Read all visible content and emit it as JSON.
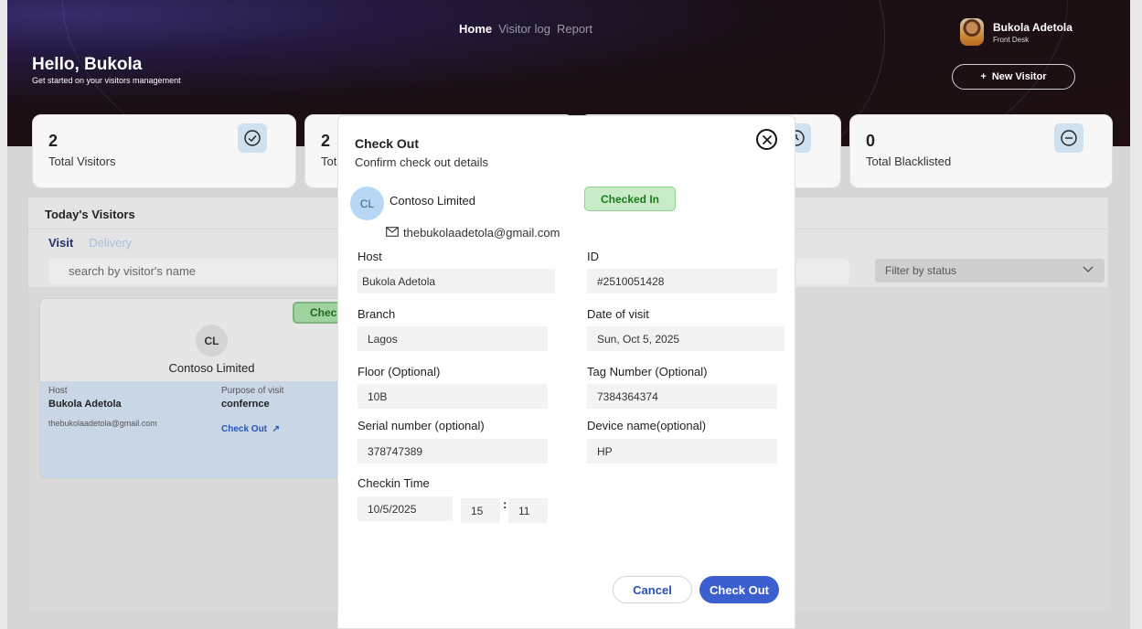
{
  "header": {
    "greeting": "Hello, Bukola",
    "subtitle": "Get started on your visitors management",
    "nav": [
      "Home",
      "Visitor log",
      "Report"
    ],
    "active_nav": "Home",
    "user_name": "Bukola Adetola",
    "user_role": "Front Desk",
    "new_visitor_label": "New Visitor"
  },
  "stats": [
    {
      "value": "2",
      "label": "Total Visitors",
      "icon": "check-circle-icon"
    },
    {
      "value": "2",
      "label": "Tot",
      "icon": "arrow-icon"
    },
    {
      "value": "",
      "label": "",
      "icon": "clock-icon"
    },
    {
      "value": "0",
      "label": "Total Blacklisted",
      "icon": "minus-circle-icon"
    }
  ],
  "panel": {
    "title": "Today's Visitors",
    "tabs": [
      "Visit",
      "Delivery"
    ],
    "search_placeholder": "search by visitor's name",
    "filter_label": "Filter by status"
  },
  "visitor_card": {
    "status_peek": "Check",
    "initials": "CL",
    "company": "Contoso Limited",
    "host_label": "Host",
    "host": "Bukola Adetola",
    "purpose_label": "Purpose of visit",
    "purpose": "confernce",
    "email": "thebukolaadetola@gmail.com",
    "checkout_link": "Check Out"
  },
  "modal": {
    "title": "Check Out",
    "subtitle": "Confirm check out details",
    "initials": "CL",
    "company": "Contoso Limited",
    "email": "thebukolaadetola@gmail.com",
    "status": "Checked In",
    "fields": {
      "host": {
        "label": "Host",
        "value": "Bukola Adetola"
      },
      "id": {
        "label": "ID",
        "value": "#2510051428"
      },
      "branch": {
        "label": "Branch",
        "value": "Lagos"
      },
      "date": {
        "label": "Date of visit",
        "value": "Sun, Oct 5, 2025"
      },
      "floor": {
        "label": "Floor (Optional)",
        "value": "10B"
      },
      "tag": {
        "label": "Tag Number (Optional)",
        "value": "7384364374"
      },
      "serial": {
        "label": "Serial number (optional)",
        "value": "378747389"
      },
      "device": {
        "label": "Device name(optional)",
        "value": "HP"
      },
      "checkin": {
        "label": "Checkin Time",
        "date": "10/5/2025",
        "hour": "15",
        "minute": "11",
        "separator": ":"
      }
    },
    "cancel_label": "Cancel",
    "checkout_label": "Check Out"
  },
  "colors": {
    "primary": "#3c5fcf",
    "status_green": "#1b7a1b",
    "hero_dark": "#1a0f14"
  }
}
